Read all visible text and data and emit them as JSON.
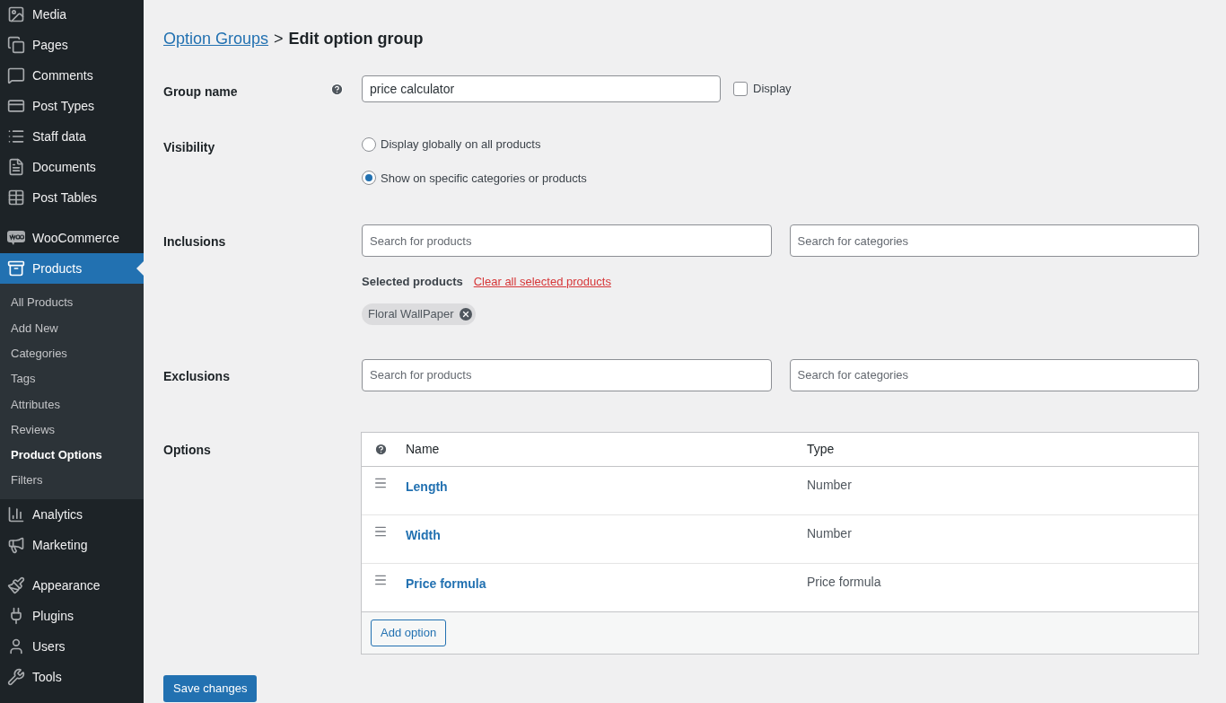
{
  "sidebar": {
    "sections": [
      [
        {
          "label": "Media",
          "selected": false
        },
        {
          "label": "Pages",
          "selected": false
        },
        {
          "label": "Comments",
          "selected": false
        },
        {
          "label": "Post Types",
          "selected": false
        },
        {
          "label": "Staff data",
          "selected": false
        },
        {
          "label": "Documents",
          "selected": false
        },
        {
          "label": "Post Tables",
          "selected": false
        }
      ],
      [
        {
          "label": "WooCommerce",
          "selected": false
        },
        {
          "label": "Products",
          "selected": true,
          "children": [
            {
              "label": "All Products",
              "selected": false
            },
            {
              "label": "Add New",
              "selected": false
            },
            {
              "label": "Categories",
              "selected": false
            },
            {
              "label": "Tags",
              "selected": false
            },
            {
              "label": "Attributes",
              "selected": false
            },
            {
              "label": "Reviews",
              "selected": false
            },
            {
              "label": "Product Options",
              "selected": true
            },
            {
              "label": "Filters",
              "selected": false
            }
          ]
        },
        {
          "label": "Analytics",
          "selected": false
        },
        {
          "label": "Marketing",
          "selected": false
        }
      ],
      [
        {
          "label": "Appearance",
          "selected": false
        },
        {
          "label": "Plugins",
          "selected": false
        },
        {
          "label": "Users",
          "selected": false
        },
        {
          "label": "Tools",
          "selected": false
        }
      ]
    ]
  },
  "breadcrumb": {
    "link": "Option Groups",
    "separator": ">",
    "current": "Edit option group"
  },
  "group_name": {
    "label": "Group name",
    "value": "price calculator",
    "display_checkbox": {
      "label": "Display",
      "checked": false
    }
  },
  "visibility": {
    "label": "Visibility",
    "options": [
      {
        "label": "Display globally on all products",
        "selected": false
      },
      {
        "label": "Show on specific categories or products",
        "selected": true
      }
    ]
  },
  "inclusions": {
    "label": "Inclusions",
    "products_placeholder": "Search for products",
    "categories_placeholder": "Search for categories",
    "selected_label": "Selected products",
    "clear_link": "Clear all selected products",
    "chips": [
      {
        "label": "Floral WallPaper"
      }
    ]
  },
  "exclusions": {
    "label": "Exclusions",
    "products_placeholder": "Search for products",
    "categories_placeholder": "Search for categories"
  },
  "options": {
    "label": "Options",
    "columns": [
      "Name",
      "Type"
    ],
    "rows": [
      {
        "name": "Length",
        "type": "Number"
      },
      {
        "name": "Width",
        "type": "Number"
      },
      {
        "name": "Price formula",
        "type": "Price formula"
      }
    ],
    "add_button": "Add option"
  },
  "save_button": "Save changes"
}
